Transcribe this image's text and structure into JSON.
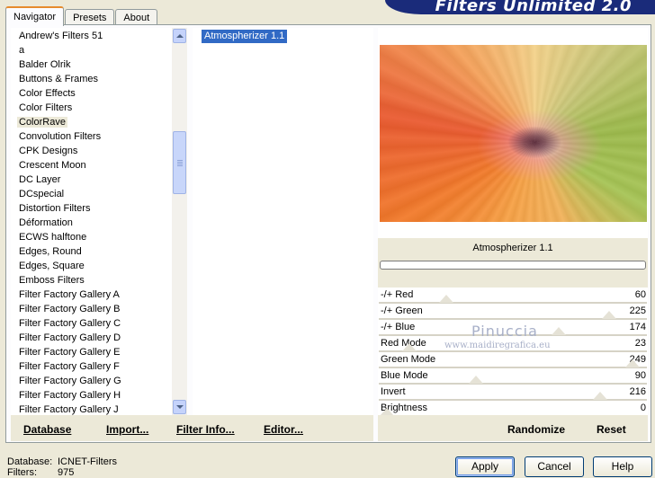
{
  "tabs": [
    {
      "label": "Navigator",
      "active": true
    },
    {
      "label": "Presets",
      "active": false
    },
    {
      "label": "About",
      "active": false
    }
  ],
  "banner": {
    "title": "Filters Unlimited 2.0",
    "color": "#1a2b7a"
  },
  "categories": {
    "selected": "ColorRave",
    "items": [
      "Andrew's Filters 51",
      "a",
      "Balder Olrik",
      "Buttons & Frames",
      "Color Effects",
      "Color Filters",
      "ColorRave",
      "Convolution Filters",
      "CPK Designs",
      "Crescent Moon",
      "DC Layer",
      "DCspecial",
      "Distortion Filters",
      "Déformation",
      "ECWS halftone",
      "Edges, Round",
      "Edges, Square",
      "Emboss Filters",
      "Filter Factory Gallery A",
      "Filter Factory Gallery B",
      "Filter Factory Gallery C",
      "Filter Factory Gallery D",
      "Filter Factory Gallery E",
      "Filter Factory Gallery F",
      "Filter Factory Gallery G",
      "Filter Factory Gallery H",
      "Filter Factory Gallery J"
    ]
  },
  "filters": {
    "items": [
      "Atmospherizer 1.1"
    ],
    "selected": "Atmospherizer 1.1",
    "selected_bg": "#316ac5"
  },
  "preview": {
    "filter_name": "Atmospherizer 1.1",
    "progress": 0
  },
  "parameters": [
    {
      "label": "-/+ Red",
      "value": "60",
      "level": 0.235
    },
    {
      "label": "-/+ Green",
      "value": "225",
      "level": 0.882
    },
    {
      "label": "-/+ Blue",
      "value": "174",
      "level": 0.682
    },
    {
      "label": "Red Mode",
      "value": "23",
      "level": 0.09
    },
    {
      "label": "Green Mode",
      "value": "249",
      "level": 0.976
    },
    {
      "label": "Blue Mode",
      "value": "90",
      "level": 0.353
    },
    {
      "label": "Invert",
      "value": "216",
      "level": 0.847
    },
    {
      "label": "Brightness",
      "value": "0",
      "level": 0.0
    }
  ],
  "watermark": {
    "line1": "Pinuccia",
    "line2": "www.maidiregrafica.eu"
  },
  "left_buttons": {
    "database": "Database",
    "import": "Import...",
    "filter_info": "Filter Info...",
    "editor": "Editor..."
  },
  "right_buttons": {
    "randomize": "Randomize",
    "reset": "Reset"
  },
  "status": {
    "database_label": "Database:",
    "database_value": "ICNET-Filters",
    "filters_label": "Filters:",
    "filters_value": "975"
  },
  "dialog_buttons": {
    "apply": "Apply",
    "cancel": "Cancel",
    "help": "Help"
  }
}
